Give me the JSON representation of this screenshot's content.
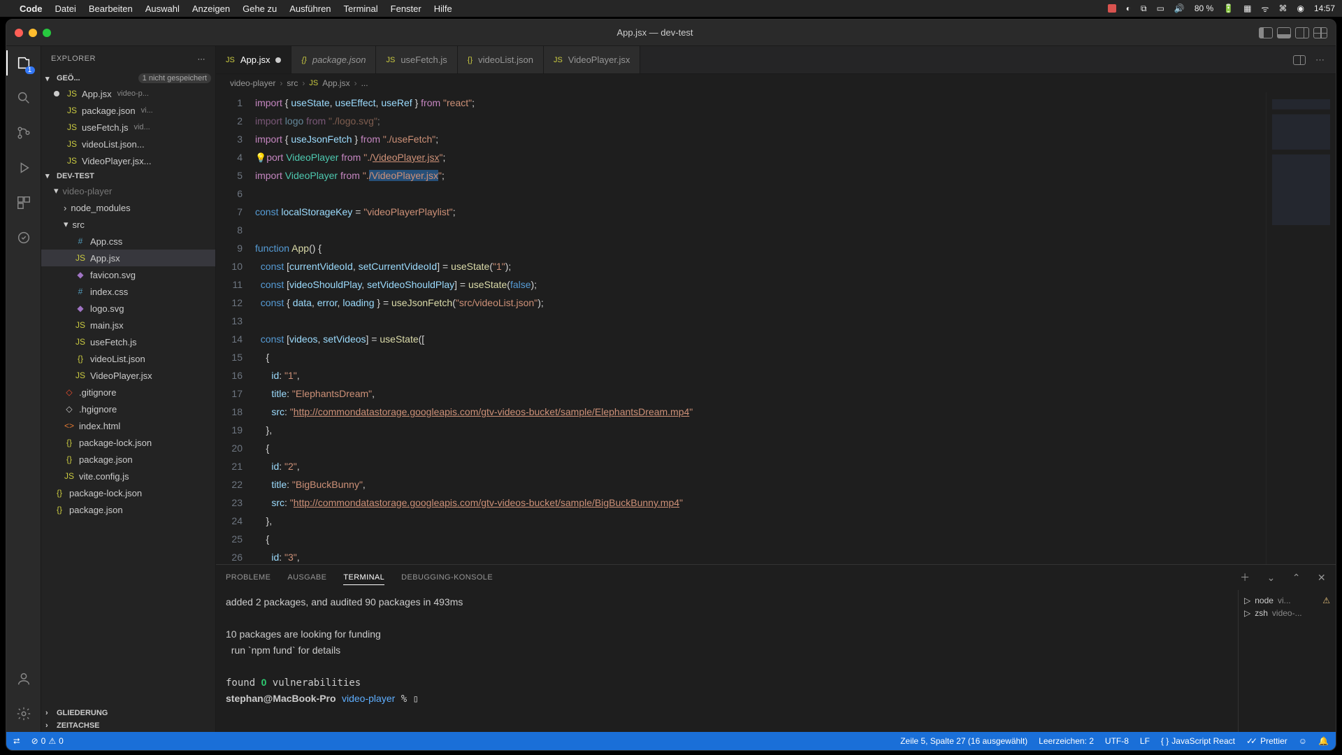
{
  "menubar": {
    "app": "Code",
    "items": [
      "Datei",
      "Bearbeiten",
      "Auswahl",
      "Anzeigen",
      "Gehe zu",
      "Ausführen",
      "Terminal",
      "Fenster",
      "Hilfe"
    ],
    "battery": "80 %",
    "clock": "14:57"
  },
  "window": {
    "title": "App.jsx — dev-test"
  },
  "activity": {
    "badge": "1"
  },
  "explorer": {
    "title": "EXPLORER",
    "open_editors_label": "GEÖ...",
    "unsaved_badge": "1 nicht gespeichert",
    "open_editors": [
      {
        "name": "App.jsx",
        "dim": "video-p...",
        "modified": true
      },
      {
        "name": "package.json",
        "dim": "vi..."
      },
      {
        "name": "useFetch.js",
        "dim": "vid..."
      },
      {
        "name": "videoList.json..."
      },
      {
        "name": "VideoPlayer.jsx..."
      }
    ],
    "project": "DEV-TEST",
    "tree": [
      {
        "name": "video-player",
        "chev": "▾",
        "ind": 0,
        "dim": true
      },
      {
        "name": "node_modules",
        "chev": "›",
        "ind": 1
      },
      {
        "name": "src",
        "chev": "▾",
        "ind": 1
      },
      {
        "name": "App.css",
        "ico": "#",
        "ind": 2,
        "cls": "ic-css"
      },
      {
        "name": "App.jsx",
        "ico": "JS",
        "ind": 2,
        "cls": "ic-js",
        "sel": true
      },
      {
        "name": "favicon.svg",
        "ico": "◆",
        "ind": 2,
        "cls": "ic-svg"
      },
      {
        "name": "index.css",
        "ico": "#",
        "ind": 2,
        "cls": "ic-css"
      },
      {
        "name": "logo.svg",
        "ico": "◆",
        "ind": 2,
        "cls": "ic-svg"
      },
      {
        "name": "main.jsx",
        "ico": "JS",
        "ind": 2,
        "cls": "ic-js"
      },
      {
        "name": "useFetch.js",
        "ico": "JS",
        "ind": 2,
        "cls": "ic-js"
      },
      {
        "name": "videoList.json",
        "ico": "{}",
        "ind": 2,
        "cls": "ic-json"
      },
      {
        "name": "VideoPlayer.jsx",
        "ico": "JS",
        "ind": 2,
        "cls": "ic-js"
      },
      {
        "name": ".gitignore",
        "ico": "◇",
        "ind": 1,
        "cls": "ic-git"
      },
      {
        "name": ".hgignore",
        "ico": "◇",
        "ind": 1
      },
      {
        "name": "index.html",
        "ico": "<>",
        "ind": 1,
        "cls": "ic-html"
      },
      {
        "name": "package-lock.json",
        "ico": "{}",
        "ind": 1,
        "cls": "ic-json"
      },
      {
        "name": "package.json",
        "ico": "{}",
        "ind": 1,
        "cls": "ic-json"
      },
      {
        "name": "vite.config.js",
        "ico": "JS",
        "ind": 1,
        "cls": "ic-js"
      },
      {
        "name": "package-lock.json",
        "ico": "{}",
        "ind": 0,
        "cls": "ic-json"
      },
      {
        "name": "package.json",
        "ico": "{}",
        "ind": 0,
        "cls": "ic-json"
      }
    ],
    "outline": "GLIEDERUNG",
    "timeline": "ZEITACHSE"
  },
  "tabs": [
    {
      "label": "App.jsx",
      "ico": "JS",
      "active": true,
      "modified": true,
      "cls": "ic-js"
    },
    {
      "label": "package.json",
      "ico": "{}",
      "italic": true,
      "cls": "ic-json"
    },
    {
      "label": "useFetch.js",
      "ico": "JS",
      "cls": "ic-js"
    },
    {
      "label": "videoList.json",
      "ico": "{}",
      "cls": "ic-json"
    },
    {
      "label": "VideoPlayer.jsx",
      "ico": "JS",
      "cls": "ic-js"
    }
  ],
  "breadcrumb": [
    "video-player",
    "src",
    "App.jsx",
    "..."
  ],
  "code": {
    "lines": [
      1,
      2,
      3,
      4,
      5,
      6,
      7,
      8,
      9,
      10,
      11,
      12,
      13,
      14,
      15,
      16,
      17,
      18,
      19,
      20,
      21,
      22,
      23,
      24,
      25,
      26
    ],
    "content": {
      "l1": "import { useState, useEffect, useRef } from \"react\";",
      "l2": "import logo from \"./logo.svg\";",
      "l3": "import { useJsonFetch } from \"./useFetch\";",
      "l4": "import VideoPlayer from \"./VideoPlayer.jsx\";",
      "l5": "import VideoPlayer from \"./VideoPlayer.jsx\";",
      "l7": "const localStorageKey = \"videoPlayerPlaylist\";",
      "l9": "function App() {",
      "l10": "  const [currentVideoId, setCurrentVideoId] = useState(\"1\");",
      "l11": "  const [videoShouldPlay, setVideoShouldPlay] = useState(false);",
      "l12": "  const { data, error, loading } = useJsonFetch(\"src/videoList.json\");",
      "l14": "  const [videos, setVideos] = useState([",
      "l15": "    {",
      "l16": "      id: \"1\",",
      "l17": "      title: \"ElephantsDream\",",
      "l18": "      src: \"http://commondatastorage.googleapis.com/gtv-videos-bucket/sample/ElephantsDream.mp4\"",
      "l19": "    },",
      "l20": "    {",
      "l21": "      id: \"2\",",
      "l22": "      title: \"BigBuckBunny\",",
      "l23": "      src: \"http://commondatastorage.googleapis.com/gtv-videos-bucket/sample/BigBuckBunny.mp4\"",
      "l24": "    },",
      "l25": "    {",
      "l26": "      id: \"3\","
    }
  },
  "panel": {
    "tabs": [
      "PROBLEME",
      "AUSGABE",
      "TERMINAL",
      "DEBUGGING-KONSOLE"
    ],
    "active": 2,
    "terminal": {
      "l1": "added 2 packages, and audited 90 packages in 493ms",
      "l2": "",
      "l3": "10 packages are looking for funding",
      "l4": "  run `npm fund` for details",
      "l5": "",
      "l6": "found 0 vulnerabilities",
      "l7": "stephan@MacBook-Pro video-player % ▯"
    },
    "sessions": [
      {
        "name": "node",
        "dim": "vi...",
        "warn": true
      },
      {
        "name": "zsh",
        "dim": "video-..."
      }
    ]
  },
  "status": {
    "errors": "0",
    "warnings": "0",
    "cursor": "Zeile 5, Spalte 27 (16 ausgewählt)",
    "spaces": "Leerzeichen: 2",
    "encoding": "UTF-8",
    "eol": "LF",
    "lang": "JavaScript React",
    "prettier": "Prettier"
  }
}
